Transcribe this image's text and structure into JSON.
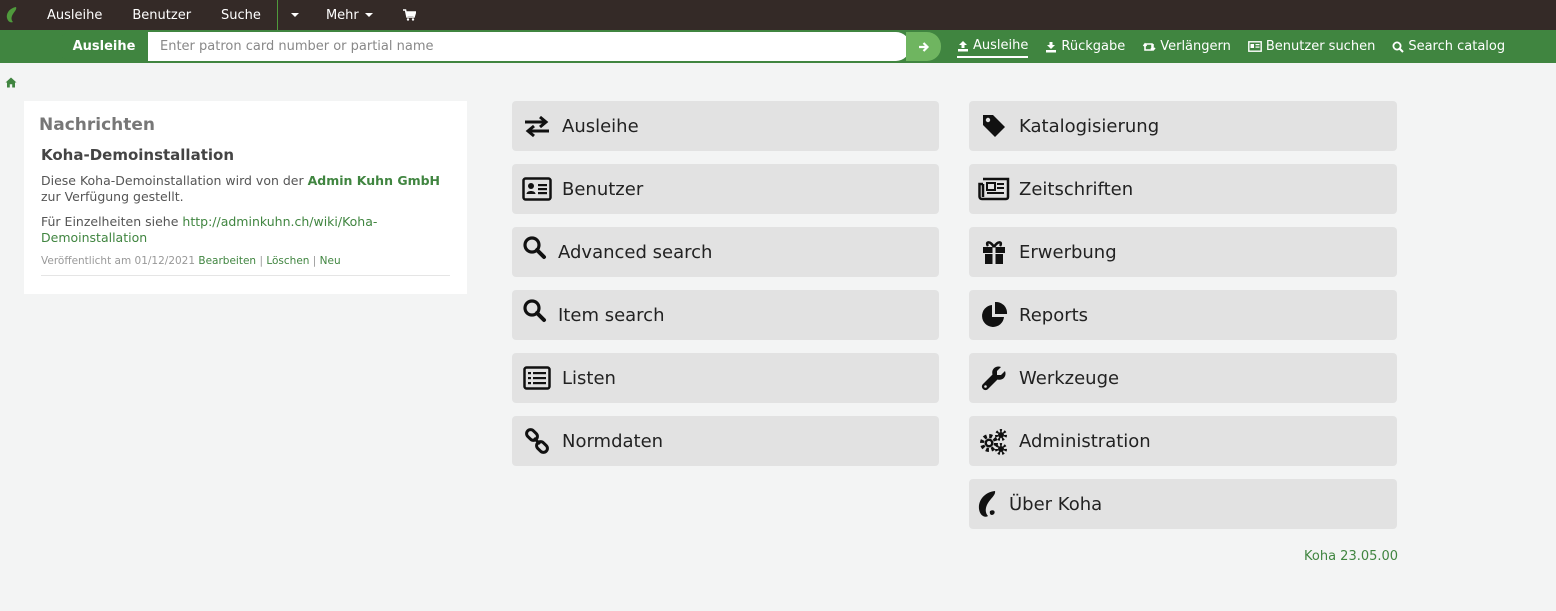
{
  "topnav": {
    "items": [
      {
        "label": "Ausleihe"
      },
      {
        "label": "Benutzer"
      },
      {
        "label": "Suche"
      }
    ],
    "more_label": "Mehr"
  },
  "header": {
    "search_label": "Ausleihe",
    "search_placeholder": "Enter patron card number or partial name",
    "tools": [
      {
        "label": "Ausleihe",
        "icon": "upload-icon"
      },
      {
        "label": "Rückgabe",
        "icon": "download-icon"
      },
      {
        "label": "Verlängern",
        "icon": "retweet-icon"
      },
      {
        "label": "Benutzer suchen",
        "icon": "id-card-icon"
      },
      {
        "label": "Search catalog",
        "icon": "search-icon"
      }
    ]
  },
  "news": {
    "heading": "Nachrichten",
    "title": "Koha-Demoinstallation",
    "text_before": "Diese Koha-Demoinstallation wird von der ",
    "link_company": "Admin Kuhn GmbH",
    "text_after": " zur Verfügung gestellt.",
    "details_prefix": "Für Einzelheiten siehe ",
    "details_link": "http://adminkuhn.ch/wiki/Koha-Demoinstallation",
    "meta_published": "Veröffentlicht am 01/12/2021",
    "edit_label": "Bearbeiten",
    "delete_label": "Löschen",
    "new_label": "Neu",
    "separator": "|"
  },
  "modules": {
    "left": [
      {
        "label": "Ausleihe",
        "icon": "exchange-icon"
      },
      {
        "label": "Benutzer",
        "icon": "id-card-icon"
      },
      {
        "label": "Advanced search",
        "icon": "search-icon"
      },
      {
        "label": "Item search",
        "icon": "search-icon"
      },
      {
        "label": "Listen",
        "icon": "list-icon"
      },
      {
        "label": "Normdaten",
        "icon": "link-icon"
      }
    ],
    "right": [
      {
        "label": "Katalogisierung",
        "icon": "tag-icon"
      },
      {
        "label": "Zeitschriften",
        "icon": "newspaper-icon"
      },
      {
        "label": "Erwerbung",
        "icon": "gift-icon"
      },
      {
        "label": "Reports",
        "icon": "pie-chart-icon"
      },
      {
        "label": "Werkzeuge",
        "icon": "wrench-icon"
      },
      {
        "label": "Administration",
        "icon": "cogs-icon"
      },
      {
        "label": "Über Koha",
        "icon": "koha-logo-icon"
      }
    ]
  },
  "footer": {
    "version": "Koha 23.05.00"
  },
  "colors": {
    "nav_bg": "#342a27",
    "header_bg": "#408540",
    "accent": "#408540",
    "tile_bg": "#e2e2e2"
  }
}
